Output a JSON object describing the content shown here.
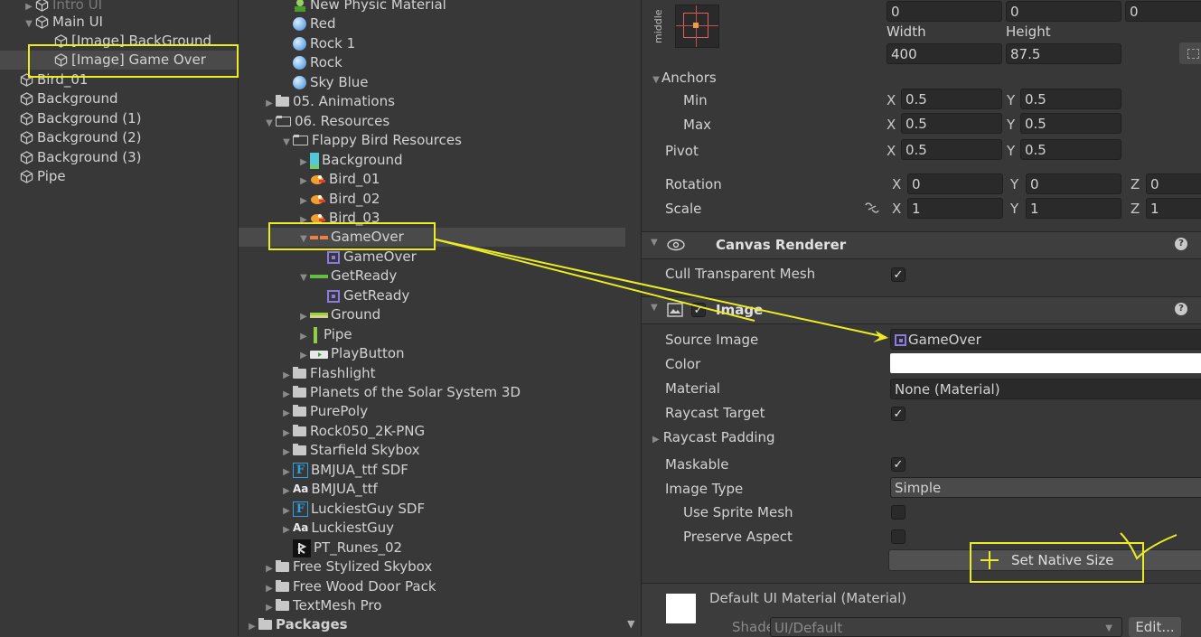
{
  "hierarchy": {
    "items": [
      {
        "label": "Intro UI",
        "indent": 1,
        "expand": "▶",
        "dim": true
      },
      {
        "label": "Main UI",
        "indent": 1,
        "expand": "▼"
      },
      {
        "label": "[Image] BackGround",
        "indent": 2
      },
      {
        "label": "[Image] Game Over",
        "indent": 2,
        "selected": true
      },
      {
        "label": "Bird_01",
        "indent": 0
      },
      {
        "label": "Background",
        "indent": 0
      },
      {
        "label": "Background (1)",
        "indent": 0
      },
      {
        "label": "Background (2)",
        "indent": 0
      },
      {
        "label": "Background (3)",
        "indent": 0
      },
      {
        "label": "Pipe",
        "indent": 0
      }
    ]
  },
  "project": {
    "items": [
      {
        "label": "New Physic Material",
        "indent": 2,
        "icon": "physic"
      },
      {
        "label": "Red",
        "indent": 2,
        "icon": "sphere"
      },
      {
        "label": "Rock 1",
        "indent": 2,
        "icon": "sphere"
      },
      {
        "label": "Rock",
        "indent": 2,
        "icon": "sphere"
      },
      {
        "label": "Sky Blue",
        "indent": 2,
        "icon": "sphere"
      },
      {
        "label": "05. Animations",
        "indent": 1,
        "icon": "folder",
        "expand": "▶"
      },
      {
        "label": "06. Resources",
        "indent": 1,
        "icon": "folder-open",
        "expand": "▼"
      },
      {
        "label": "Flappy Bird Resources",
        "indent": 2,
        "icon": "folder-open",
        "expand": "▼"
      },
      {
        "label": "Background",
        "indent": 3,
        "icon": "bg-thumb",
        "expand": "▶"
      },
      {
        "label": "Bird_01",
        "indent": 3,
        "icon": "bird-thumb",
        "expand": "▶"
      },
      {
        "label": "Bird_02",
        "indent": 3,
        "icon": "bird-thumb",
        "expand": "▶"
      },
      {
        "label": "Bird_03",
        "indent": 3,
        "icon": "bird-thumb",
        "expand": "▶"
      },
      {
        "label": "GameOver",
        "indent": 3,
        "icon": "gameover-thumb",
        "expand": "▼",
        "selected": true
      },
      {
        "label": "GameOver",
        "indent": 4,
        "icon": "sprite"
      },
      {
        "label": "GetReady",
        "indent": 3,
        "icon": "getready-thumb",
        "expand": "▼"
      },
      {
        "label": "GetReady",
        "indent": 4,
        "icon": "sprite"
      },
      {
        "label": "Ground",
        "indent": 3,
        "icon": "ground-thumb",
        "expand": "▶"
      },
      {
        "label": "Pipe",
        "indent": 3,
        "icon": "pipe-thumb",
        "expand": "▶"
      },
      {
        "label": "PlayButton",
        "indent": 3,
        "icon": "play-thumb",
        "expand": "▶"
      },
      {
        "label": "Flashlight",
        "indent": 2,
        "icon": "folder",
        "expand": "▶"
      },
      {
        "label": "Planets of the Solar System 3D",
        "indent": 2,
        "icon": "folder",
        "expand": "▶"
      },
      {
        "label": "PurePoly",
        "indent": 2,
        "icon": "folder",
        "expand": "▶"
      },
      {
        "label": "Rock050_2K-PNG",
        "indent": 2,
        "icon": "folder",
        "expand": "▶"
      },
      {
        "label": "Starfield Skybox",
        "indent": 2,
        "icon": "folder",
        "expand": "▶"
      },
      {
        "label": "BMJUA_ttf SDF",
        "indent": 2,
        "icon": "fontF",
        "expand": "▶"
      },
      {
        "label": "BMJUA_ttf",
        "indent": 2,
        "icon": "fontAa",
        "expand": "▶"
      },
      {
        "label": "LuckiestGuy SDF",
        "indent": 2,
        "icon": "fontF",
        "expand": "▶"
      },
      {
        "label": "LuckiestGuy",
        "indent": 2,
        "icon": "fontAa",
        "expand": "▶"
      },
      {
        "label": "PT_Runes_02",
        "indent": 2,
        "icon": "runes"
      },
      {
        "label": "Free Stylized Skybox",
        "indent": 1,
        "icon": "folder",
        "expand": "▶"
      },
      {
        "label": "Free Wood Door Pack",
        "indent": 1,
        "icon": "folder",
        "expand": "▶"
      },
      {
        "label": "TextMesh Pro",
        "indent": 1,
        "icon": "folder",
        "expand": "▶"
      },
      {
        "label": "Packages",
        "indent": 0,
        "icon": "folder",
        "expand": "▶",
        "bold": true
      }
    ],
    "icon_font_text": "Aa",
    "icon_sdf_text": "F"
  },
  "inspector": {
    "anchor_preset_label": "middle",
    "pos_values": [
      "0",
      "0",
      "0"
    ],
    "width_label": "Width",
    "height_label": "Height",
    "width": "400",
    "height": "87.5",
    "anchors_label": "Anchors",
    "min_label": "Min",
    "max_label": "Max",
    "pivot_label": "Pivot",
    "anchor_min": {
      "x": "0.5",
      "y": "0.5"
    },
    "anchor_max": {
      "x": "0.5",
      "y": "0.5"
    },
    "pivot": {
      "x": "0.5",
      "y": "0.5"
    },
    "rotation_label": "Rotation",
    "rotation": {
      "x": "0",
      "y": "0",
      "z": "0"
    },
    "scale_label": "Scale",
    "scale": {
      "x": "1",
      "y": "1",
      "z": "1"
    },
    "axis": {
      "x": "X",
      "y": "Y",
      "z": "Z"
    },
    "canvas_renderer": {
      "title": "Canvas Renderer",
      "cull_label": "Cull Transparent Mesh",
      "cull_checked": true
    },
    "image": {
      "title": "Image",
      "enabled": true,
      "source_image_label": "Source Image",
      "source_image": "GameOver",
      "color_label": "Color",
      "color": "#ffffff",
      "material_label": "Material",
      "material": "None (Material)",
      "raycast_target_label": "Raycast Target",
      "raycast_target": true,
      "raycast_padding_label": "Raycast Padding",
      "maskable_label": "Maskable",
      "maskable": true,
      "image_type_label": "Image Type",
      "image_type": "Simple",
      "use_sprite_mesh_label": "Use Sprite Mesh",
      "preserve_aspect_label": "Preserve Aspect",
      "set_native_size": "Set Native Size"
    },
    "material_footer": {
      "title": "Default UI Material (Material)",
      "shader_label": "Shader",
      "shader": "UI/Default",
      "edit_label": "Edit..."
    },
    "help_glyph": "?",
    "check_glyph": "✓"
  },
  "colors": {
    "annotation": "#ecec25",
    "background": "#383838",
    "field": "#2a2a2a"
  }
}
